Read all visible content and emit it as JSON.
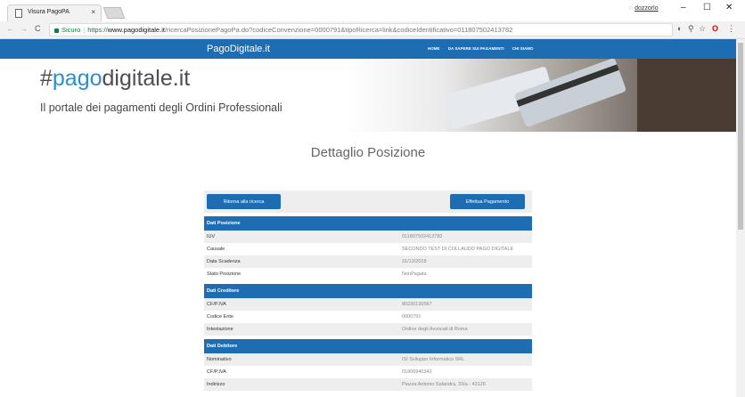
{
  "browser": {
    "tab_title": "Visura PagoPA",
    "tab_close": "×",
    "user_badge_glyph": "◌",
    "user_name": "dozzorlo",
    "window_controls": [
      "–",
      "☐",
      "✕"
    ],
    "nav_back": "←",
    "nav_forward": "→",
    "nav_reload": "C",
    "secure_label": "Sicuro",
    "url_protocol": "https://",
    "url_host": "www.pagodigitale.it",
    "url_path": "/ricercaPosizionePagoPa.do?codiceConvenzione=0000791&tipoRicerca=link&codiceIdentificativo=011807502413782",
    "toolbar_icons": [
      "pin-icon",
      "zoom-icon",
      "star-icon",
      "opera-icon",
      "menu-icon"
    ],
    "toolbar_glyphs": [
      "◐",
      "⚲",
      "☆",
      "O",
      "⋮"
    ]
  },
  "site": {
    "brand": "PagoDigitale.it",
    "nav": [
      "HOME",
      "DA SAPERE SUI PAGAMENTI",
      "CHI SIAMO"
    ],
    "hero_title_prefix": "#",
    "hero_title_highlight": "pago",
    "hero_title_suffix": "digitale.it",
    "hero_subtitle": "Il portale dei pagamenti degli Ordini Professionali"
  },
  "detail": {
    "title": "Dettaglio Posizione",
    "back_button": "Ritorna alla ricerca",
    "pay_button": "Effettua Pagamento",
    "sections": [
      {
        "title": "Dati Posizione",
        "rows": [
          {
            "label": "IUV",
            "value": "011807502413782"
          },
          {
            "label": "Causale",
            "value": "SECONDO TEST DI COLLAUDO PAGO DIGITALE"
          },
          {
            "label": "Data Scadenza",
            "value": "31/12/2018"
          },
          {
            "label": "Stato Posizione",
            "value": "NonPagata"
          }
        ]
      },
      {
        "title": "Dati Creditore",
        "rows": [
          {
            "label": "CF/P.IVA",
            "value": "80230130587"
          },
          {
            "label": "Codice Ente",
            "value": "0000791"
          },
          {
            "label": "Intestazione",
            "value": "Ordine degli Avvocati di Roma"
          }
        ]
      },
      {
        "title": "Dati Debitore",
        "rows": [
          {
            "label": "Nominativo",
            "value": "ISI Sviluppo Informatico SRL"
          },
          {
            "label": "CF/P.IVA",
            "value": "01806940342"
          },
          {
            "label": "Indirizzo",
            "value": "Piazza Antonio Salandra, 33/a - 43126"
          }
        ]
      }
    ]
  },
  "colors": {
    "brand_blue": "#1e6db2",
    "highlight_blue": "#2a90c9",
    "row_alt": "#eeeeee"
  }
}
